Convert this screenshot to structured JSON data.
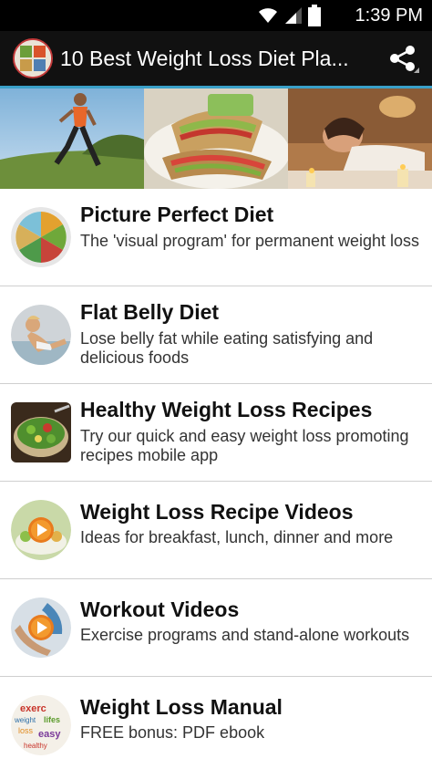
{
  "status_bar": {
    "time": "1:39 PM",
    "icons": [
      "wifi-icon",
      "signal-icon",
      "battery-icon"
    ]
  },
  "action_bar": {
    "title": "10 Best Weight Loss Diet Pla...",
    "share_icon": "share-icon",
    "accent_color": "#3aa0c8"
  },
  "banner": {
    "panels": [
      "runner-photo",
      "wraps-photo",
      "relaxing-bath-photo"
    ]
  },
  "items": [
    {
      "title": "Picture Perfect Diet",
      "description": "The 'visual program' for permanent weight loss",
      "thumb": "food-plate-thumb"
    },
    {
      "title": "Flat Belly Diet",
      "description": "Lose belly fat while eating satisfying and delicious foods",
      "thumb": "abs-workout-thumb"
    },
    {
      "title": "Healthy Weight Loss Recipes",
      "description": "Try our quick and easy weight loss promoting recipes mobile app",
      "thumb": "salad-bowl-thumb"
    },
    {
      "title": "Weight Loss Recipe Videos",
      "description": "Ideas for breakfast, lunch, dinner and more",
      "thumb": "recipe-video-thumb"
    },
    {
      "title": "Workout Videos",
      "description": "Exercise programs and stand-alone workouts",
      "thumb": "workout-video-thumb"
    },
    {
      "title": "Weight Loss Manual",
      "description": "FREE bonus: PDF ebook",
      "thumb": "word-cloud-thumb"
    }
  ]
}
